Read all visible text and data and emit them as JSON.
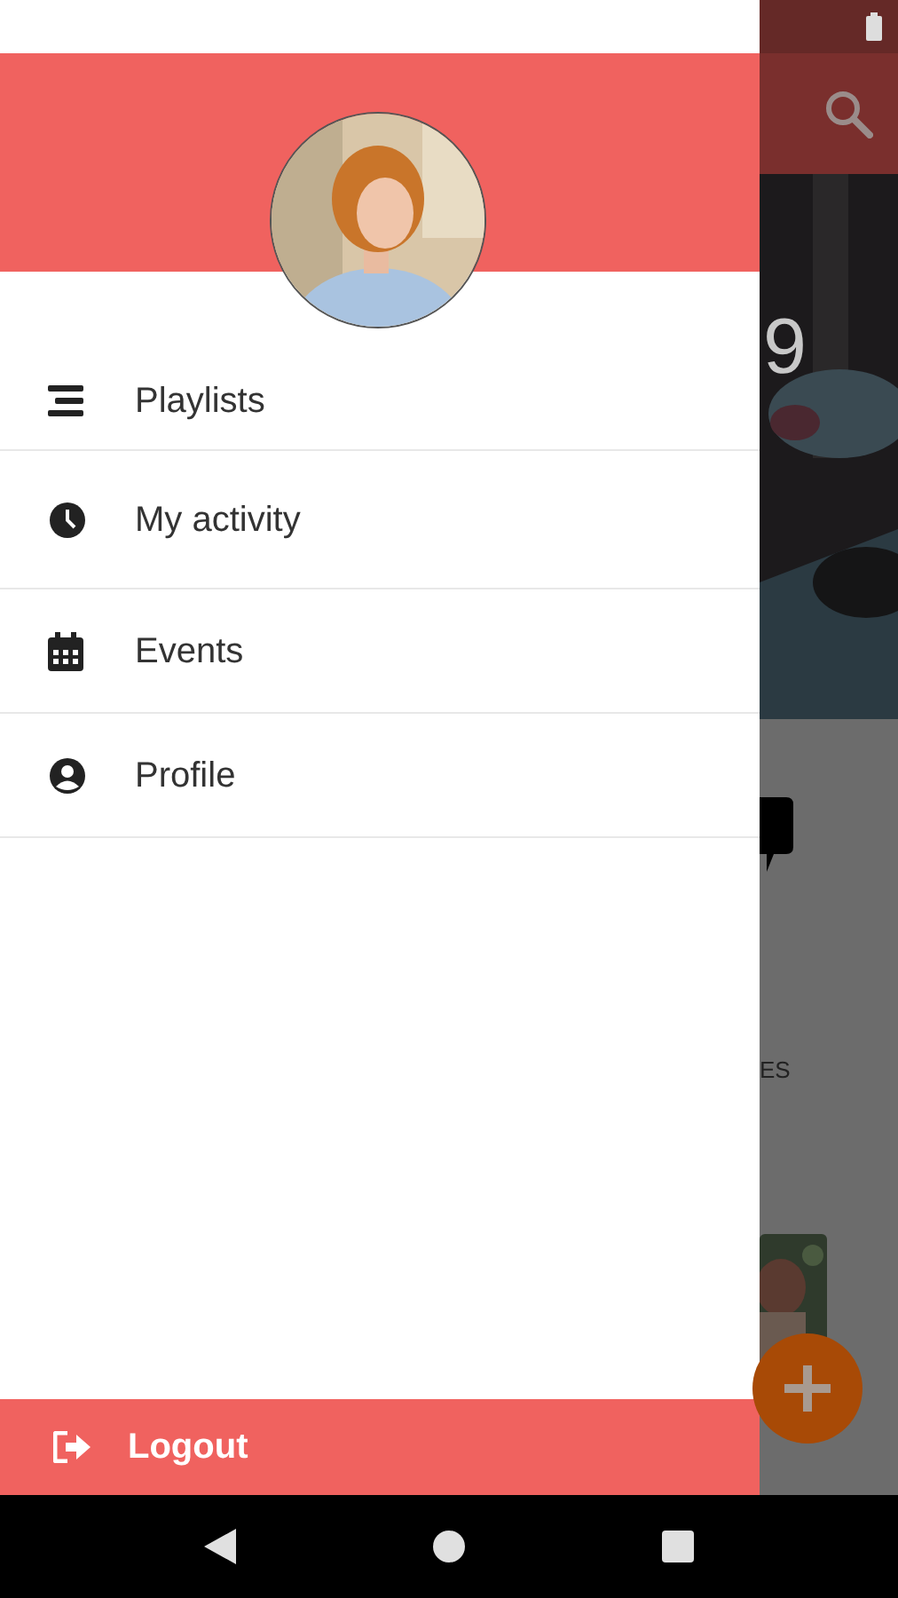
{
  "drawer": {
    "menu": [
      {
        "kind": "list",
        "label": "Playlists"
      },
      {
        "kind": "clock",
        "label": "My activity"
      },
      {
        "kind": "calendar",
        "label": "Events"
      },
      {
        "kind": "person",
        "label": "Profile"
      }
    ],
    "logout": {
      "label": "Logout"
    }
  },
  "background": {
    "banner_text": "9",
    "section_text": "ES"
  }
}
